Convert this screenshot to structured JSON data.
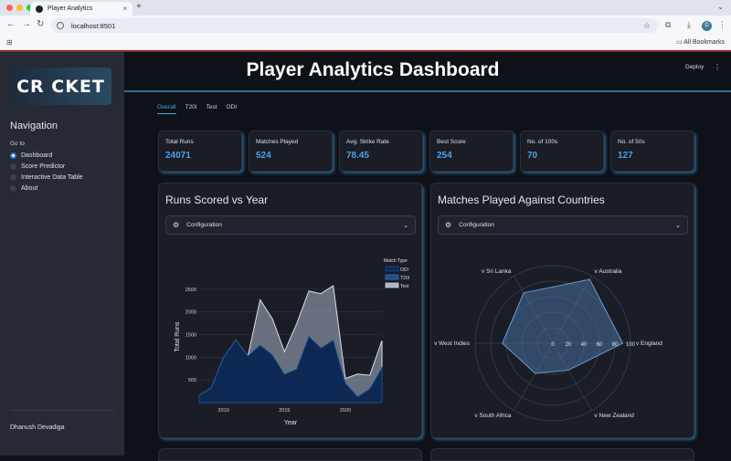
{
  "browser": {
    "tab_title": "Player Analytics",
    "url": "localhost:8501",
    "all_bookmarks": "All Bookmarks",
    "avatar_initial": "D"
  },
  "header": {
    "deploy_label": "Deploy"
  },
  "sidebar": {
    "logo_text": "CR CKET",
    "nav_title": "Navigation",
    "goto_label": "Go to",
    "items": [
      {
        "label": "Dashboard",
        "selected": true
      },
      {
        "label": "Score Predictor",
        "selected": false
      },
      {
        "label": "Interactive Data Table",
        "selected": false
      },
      {
        "label": "About",
        "selected": false
      }
    ],
    "author": "Dhanush Devadiga"
  },
  "main": {
    "title": "Player Analytics Dashboard",
    "tabs": [
      "Overall",
      "T20I",
      "Test",
      "ODI"
    ],
    "active_tab": "Overall",
    "metrics": [
      {
        "label": "Total Runs",
        "value": "24071"
      },
      {
        "label": "Matches Played",
        "value": "524"
      },
      {
        "label": "Avg. Strike Rate",
        "value": "78.45"
      },
      {
        "label": "Best Score",
        "value": "254"
      },
      {
        "label": "No. of 100s",
        "value": "70"
      },
      {
        "label": "No. of 50s",
        "value": "127"
      }
    ],
    "config_label": "Configuration"
  },
  "colors": {
    "accent": "#4da0e6",
    "background": "#0e1117",
    "sidebar": "#262a35",
    "card": "#1a1d26"
  },
  "chart_data": [
    {
      "type": "area",
      "title": "Runs Scored vs Year",
      "xlabel": "Year",
      "ylabel": "Total Runs",
      "legend_title": "Match Type",
      "legend_position": "top-right",
      "x": [
        2008,
        2009,
        2010,
        2011,
        2012,
        2013,
        2014,
        2015,
        2016,
        2017,
        2018,
        2019,
        2020,
        2021,
        2022,
        2023
      ],
      "series": [
        {
          "name": "ODI",
          "values": [
            159,
            325,
            995,
            1381,
            1026,
            1268,
            1054,
            623,
            739,
            1460,
            1202,
            1377,
            431,
            129,
            302,
            765
          ]
        },
        {
          "name": "T20I",
          "values": [
            0,
            0,
            0,
            0,
            0,
            0,
            0,
            0,
            0,
            0,
            0,
            0,
            0,
            0,
            0,
            0
          ]
        },
        {
          "name": "Test",
          "values": [
            0,
            0,
            0,
            0,
            0,
            1000,
            800,
            500,
            1000,
            1000,
            1200,
            1200,
            100,
            500,
            300,
            600
          ]
        }
      ],
      "xticks": [
        2010,
        2015,
        2020
      ],
      "yticks": [
        500,
        1000,
        1500,
        2000,
        2500
      ],
      "ylim": [
        0,
        2900
      ],
      "grid": true
    },
    {
      "type": "radar",
      "title": "Matches Played Against Countries",
      "categories": [
        "v England",
        "v Australia",
        "v Sri Lanka",
        "v West Indies",
        "v South Africa",
        "v New Zealand"
      ],
      "values": [
        90,
        95,
        75,
        65,
        45,
        40
      ],
      "radial_ticks": [
        0,
        20,
        40,
        60,
        80,
        100
      ],
      "rlim": [
        0,
        100
      ]
    }
  ]
}
